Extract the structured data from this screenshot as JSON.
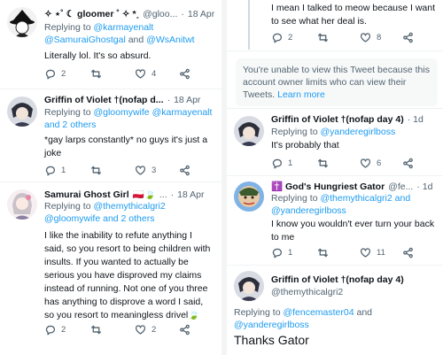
{
  "left": {
    "tweets": [
      {
        "name": "✧ ⋆˚ ☾ gloomer ˚ ✧ *˳",
        "handle": "@gloo...",
        "date": "18 Apr",
        "reply_prefix": "Replying to",
        "reply_line1": "@karmayenalt",
        "reply_line2_a": "@SamuraiGhostgal",
        "reply_and": " and ",
        "reply_line2_b": "@WsAnitwt",
        "text": [
          "Literally lol. It's so absurd."
        ],
        "replies": "2",
        "retweets": "",
        "likes": "4"
      },
      {
        "name": "Griffin of Violet †(nofap d...",
        "handle": "",
        "date": "18 Apr",
        "reply_prefix": "Replying to",
        "reply_line1_a": "@gloomywife",
        "reply_line1_b": "@karmayenalt",
        "reply_line2": "and 2 others",
        "text": [
          "*gay larps constantly* no guys it's just a",
          "joke"
        ],
        "replies": "1",
        "retweets": "",
        "likes": "3"
      },
      {
        "name": "Samurai Ghost Girl",
        "flags": "🇵🇱🍃",
        "handle": "...",
        "date": "18 Apr",
        "reply_prefix": "Replying to",
        "reply_line1": "@themythicalgri2",
        "reply_line2_a": "@gloomywife",
        "reply_line2_b": "and 2 others",
        "text": [
          "I like the inability to refute anything I",
          "said, so you resort to being children with",
          "insults. If you wanted to actually be",
          "serious you have disproved my claims",
          "instead of running. Not one of you three",
          "has anything to disprove a word I said,",
          "so you resort to meaningless drivel🍃"
        ],
        "replies": "2",
        "retweets": "",
        "likes": "2"
      }
    ]
  },
  "right": {
    "top_text": [
      "I mean I talked to meow because I want",
      "to see what her deal is."
    ],
    "top_actions": {
      "replies": "2",
      "retweets": "",
      "likes": "8"
    },
    "notice_text": "You're unable to view this Tweet because this account owner limits who can view their Tweets.",
    "notice_link": "Learn more",
    "tweets": [
      {
        "name": "Griffin of Violet †(nofap day 4)",
        "date": "· 1d",
        "reply_prefix": "Replying to",
        "reply_handle": "@yanderegirlboss",
        "text": [
          "It's probably that"
        ],
        "replies": "1",
        "retweets": "",
        "likes": "6"
      },
      {
        "name": "✝️ God's Hungriest Gator",
        "handle": "@fe...",
        "date": "· 1d",
        "reply_prefix": "Replying to",
        "reply_line1": "@themythicalgri2 and",
        "reply_line2": "@yanderegirlboss",
        "text": [
          "I know you wouldn't ever turn your back",
          "to me"
        ],
        "replies": "1",
        "retweets": "",
        "likes": "11"
      },
      {
        "name": "Griffin of Violet †(nofap day 4)",
        "handle": "@themythicalgri2",
        "reply_prefix": "Replying to",
        "reply_a": "@fencemaster04",
        "reply_and": " and",
        "reply_b": "@yanderegirlboss",
        "text": "Thanks Gator"
      }
    ]
  },
  "colors": {
    "link": "#1d9bf0",
    "muted": "#536471",
    "text": "#0f1419"
  },
  "icons": [
    "reply-icon",
    "retweet-icon",
    "like-icon",
    "share-icon",
    "more-icon"
  ]
}
